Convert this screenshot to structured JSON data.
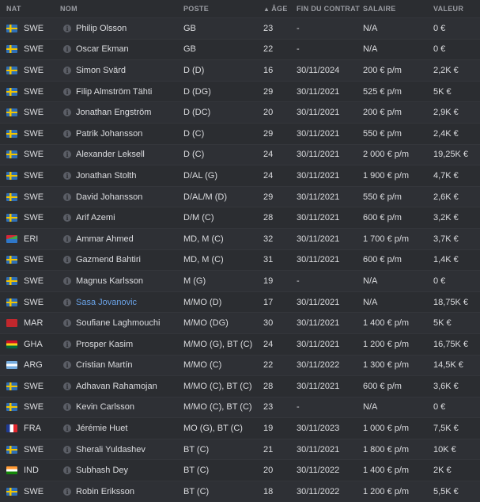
{
  "headers": {
    "nat": "NAT",
    "name": "NOM",
    "pos": "POSTE",
    "age": "ÂGE",
    "age_sort_icon": "▲",
    "contract": "FIN DU CONTRAT",
    "salary": "SALAIRE",
    "value": "VALEUR"
  },
  "players": [
    {
      "nat": "SWE",
      "flag": "sweden-flag-icon",
      "name": "Philip Olsson",
      "pos": "GB",
      "age": "23",
      "contract": "-",
      "salary": "N/A",
      "value": "0 €"
    },
    {
      "nat": "SWE",
      "flag": "sweden-flag-icon",
      "name": "Oscar Ekman",
      "pos": "GB",
      "age": "22",
      "contract": "-",
      "salary": "N/A",
      "value": "0 €"
    },
    {
      "nat": "SWE",
      "flag": "sweden-flag-icon",
      "name": "Simon Svärd",
      "pos": "D (D)",
      "age": "16",
      "contract": "30/11/2024",
      "salary": "200 € p/m",
      "value": "2,2K €"
    },
    {
      "nat": "SWE",
      "flag": "sweden-flag-icon",
      "name": "Filip Almström Tähti",
      "pos": "D (DG)",
      "age": "29",
      "contract": "30/11/2021",
      "salary": "525 € p/m",
      "value": "5K €"
    },
    {
      "nat": "SWE",
      "flag": "sweden-flag-icon",
      "name": "Jonathan Engström",
      "pos": "D (DC)",
      "age": "20",
      "contract": "30/11/2021",
      "salary": "200 € p/m",
      "value": "2,9K €"
    },
    {
      "nat": "SWE",
      "flag": "sweden-flag-icon",
      "name": "Patrik Johansson",
      "pos": "D (C)",
      "age": "29",
      "contract": "30/11/2021",
      "salary": "550 € p/m",
      "value": "2,4K €"
    },
    {
      "nat": "SWE",
      "flag": "sweden-flag-icon",
      "name": "Alexander Leksell",
      "pos": "D (C)",
      "age": "24",
      "contract": "30/11/2021",
      "salary": "2 000 € p/m",
      "value": "19,25K €"
    },
    {
      "nat": "SWE",
      "flag": "sweden-flag-icon",
      "name": "Jonathan Stolth",
      "pos": "D/AL (G)",
      "age": "24",
      "contract": "30/11/2021",
      "salary": "1 900 € p/m",
      "value": "4,7K €"
    },
    {
      "nat": "SWE",
      "flag": "sweden-flag-icon",
      "name": "David Johansson",
      "pos": "D/AL/M (D)",
      "age": "29",
      "contract": "30/11/2021",
      "salary": "550 € p/m",
      "value": "2,6K €"
    },
    {
      "nat": "SWE",
      "flag": "sweden-flag-icon",
      "name": "Arif Azemi",
      "pos": "D/M (C)",
      "age": "28",
      "contract": "30/11/2021",
      "salary": "600 € p/m",
      "value": "3,2K €"
    },
    {
      "nat": "ERI",
      "flag": "eritrea-flag-icon",
      "name": "Ammar Ahmed",
      "pos": "MD, M (C)",
      "age": "32",
      "contract": "30/11/2021",
      "salary": "1 700 € p/m",
      "value": "3,7K €"
    },
    {
      "nat": "SWE",
      "flag": "sweden-flag-icon",
      "name": "Gazmend Bahtiri",
      "pos": "MD, M (C)",
      "age": "31",
      "contract": "30/11/2021",
      "salary": "600 € p/m",
      "value": "1,4K €"
    },
    {
      "nat": "SWE",
      "flag": "sweden-flag-icon",
      "name": "Magnus Karlsson",
      "pos": "M (G)",
      "age": "19",
      "contract": "-",
      "salary": "N/A",
      "value": "0 €"
    },
    {
      "nat": "SWE",
      "flag": "sweden-flag-icon",
      "name": "Sasa Jovanovic",
      "pos": "M/MO (D)",
      "age": "17",
      "contract": "30/11/2021",
      "salary": "N/A",
      "value": "18,75K €",
      "highlight": true
    },
    {
      "nat": "MAR",
      "flag": "morocco-flag-icon",
      "name": "Soufiane Laghmouchi",
      "pos": "M/MO (DG)",
      "age": "30",
      "contract": "30/11/2021",
      "salary": "1 400 € p/m",
      "value": "5K €"
    },
    {
      "nat": "GHA",
      "flag": "ghana-flag-icon",
      "name": "Prosper Kasim",
      "pos": "M/MO (G), BT (C)",
      "age": "24",
      "contract": "30/11/2021",
      "salary": "1 200 € p/m",
      "value": "16,75K €"
    },
    {
      "nat": "ARG",
      "flag": "argentina-flag-icon",
      "name": "Cristian Martín",
      "pos": "M/MO (C)",
      "age": "22",
      "contract": "30/11/2022",
      "salary": "1 300 € p/m",
      "value": "14,5K €"
    },
    {
      "nat": "SWE",
      "flag": "sweden-flag-icon",
      "name": "Adhavan Rahamojan",
      "pos": "M/MO (C), BT (C)",
      "age": "28",
      "contract": "30/11/2021",
      "salary": "600 € p/m",
      "value": "3,6K €"
    },
    {
      "nat": "SWE",
      "flag": "sweden-flag-icon",
      "name": "Kevin Carlsson",
      "pos": "M/MO (C), BT (C)",
      "age": "23",
      "contract": "-",
      "salary": "N/A",
      "value": "0 €"
    },
    {
      "nat": "FRA",
      "flag": "france-flag-icon",
      "name": "Jérémie Huet",
      "pos": "MO (G), BT (C)",
      "age": "19",
      "contract": "30/11/2023",
      "salary": "1 000 € p/m",
      "value": "7,5K €"
    },
    {
      "nat": "SWE",
      "flag": "sweden-flag-icon",
      "name": "Sherali Yuldashev",
      "pos": "BT (C)",
      "age": "21",
      "contract": "30/11/2021",
      "salary": "1 800 € p/m",
      "value": "10K €"
    },
    {
      "nat": "IND",
      "flag": "india-flag-icon",
      "name": "Subhash Dey",
      "pos": "BT (C)",
      "age": "20",
      "contract": "30/11/2022",
      "salary": "1 400 € p/m",
      "value": "2K €"
    },
    {
      "nat": "SWE",
      "flag": "sweden-flag-icon",
      "name": "Robin Eriksson",
      "pos": "BT (C)",
      "age": "18",
      "contract": "30/11/2022",
      "salary": "1 200 € p/m",
      "value": "5,5K €"
    }
  ]
}
